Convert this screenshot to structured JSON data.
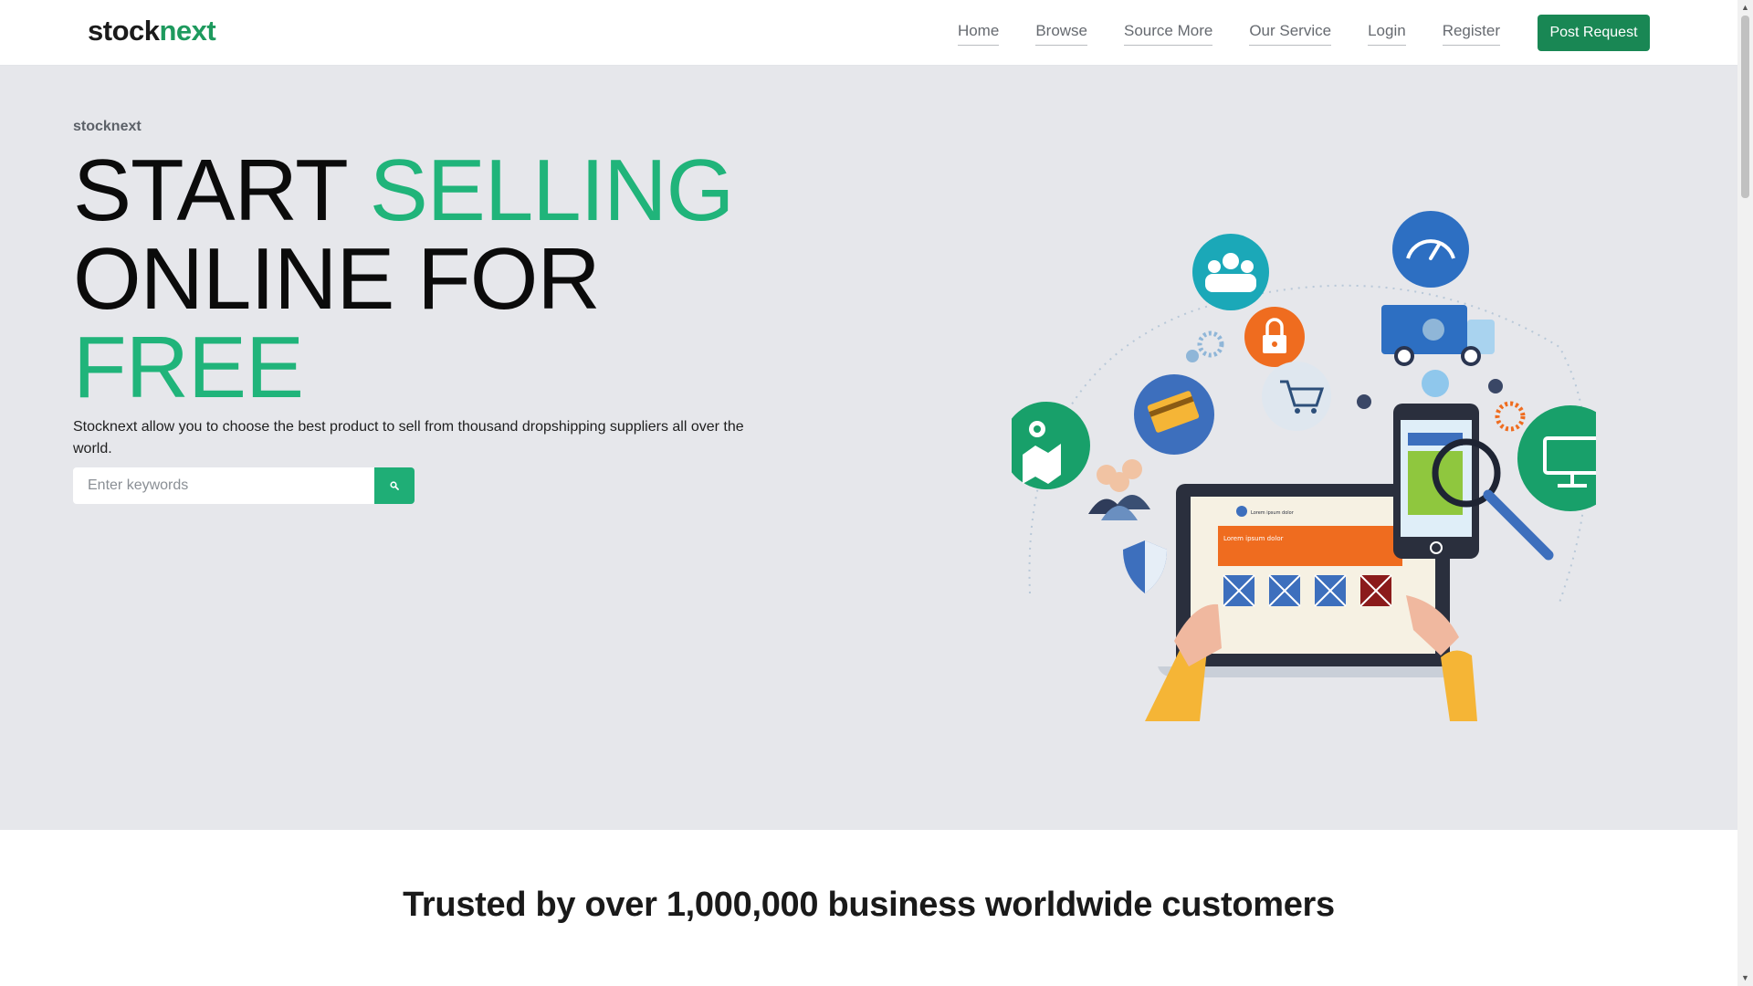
{
  "header": {
    "logo_part1": "stock",
    "logo_part2": "next",
    "nav": [
      "Home",
      "Browse",
      "Source More",
      "Our Service",
      "Login",
      "Register"
    ],
    "cta": "Post Request"
  },
  "hero": {
    "eyebrow": "stocknext",
    "headline_line1_black": "START",
    "headline_line1_green": "SELLING",
    "headline_line2": "ONLINE FOR",
    "headline_line3_green": "FREE",
    "description": "Stocknext allow you to choose the best product to sell from thousand dropshipping suppliers all over the world.",
    "search_placeholder": "Enter keywords",
    "illustration": {
      "laptop_headline": "Lorem ipsum dolor",
      "laptop_title": "Lorem ipsum dolor"
    }
  },
  "trusted": {
    "heading": "Trusted by over 1,000,000 business worldwide customers"
  },
  "colors": {
    "brand_green": "#198754",
    "accent_green": "#20b47a",
    "hero_bg": "#e6e7eb"
  }
}
